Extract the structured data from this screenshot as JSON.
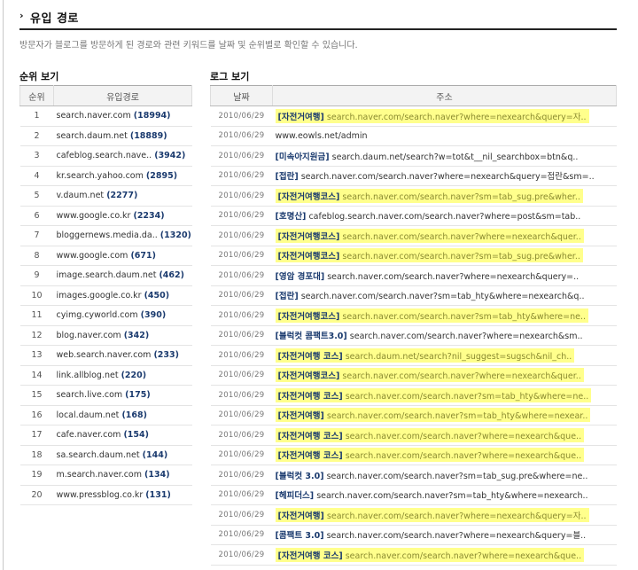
{
  "header": {
    "title": "유입 경로",
    "description": "방문자가 블로그를 방문하게 된 경로와 관련 키워드를 날짜 및 순위별로 확인할 수 있습니다."
  },
  "rank_section": {
    "label": "순위 보기",
    "columns": [
      "순위",
      "유입경로"
    ],
    "rows": [
      {
        "rank": "1",
        "source": "search.naver.com",
        "count": "(18994)"
      },
      {
        "rank": "2",
        "source": "search.daum.net",
        "count": "(18889)"
      },
      {
        "rank": "3",
        "source": "cafeblog.search.nave..",
        "count": "(3942)"
      },
      {
        "rank": "4",
        "source": "kr.search.yahoo.com",
        "count": "(2895)"
      },
      {
        "rank": "5",
        "source": "v.daum.net",
        "count": "(2277)"
      },
      {
        "rank": "6",
        "source": "www.google.co.kr",
        "count": "(2234)"
      },
      {
        "rank": "7",
        "source": "bloggernews.media.da..",
        "count": "(1320)"
      },
      {
        "rank": "8",
        "source": "www.google.com",
        "count": "(671)"
      },
      {
        "rank": "9",
        "source": "image.search.daum.net",
        "count": "(462)"
      },
      {
        "rank": "10",
        "source": "images.google.co.kr",
        "count": "(450)"
      },
      {
        "rank": "11",
        "source": "cyimg.cyworld.com",
        "count": "(390)"
      },
      {
        "rank": "12",
        "source": "blog.naver.com",
        "count": "(342)"
      },
      {
        "rank": "13",
        "source": "web.search.naver.com",
        "count": "(233)"
      },
      {
        "rank": "14",
        "source": "link.allblog.net",
        "count": "(220)"
      },
      {
        "rank": "15",
        "source": "search.live.com",
        "count": "(175)"
      },
      {
        "rank": "16",
        "source": "local.daum.net",
        "count": "(168)"
      },
      {
        "rank": "17",
        "source": "cafe.naver.com",
        "count": "(154)"
      },
      {
        "rank": "18",
        "source": "sa.search.daum.net",
        "count": "(144)"
      },
      {
        "rank": "19",
        "source": "m.search.naver.com",
        "count": "(134)"
      },
      {
        "rank": "20",
        "source": "www.pressblog.co.kr",
        "count": "(131)"
      }
    ]
  },
  "log_section": {
    "label": "로그 보기",
    "columns": [
      "날짜",
      "주소"
    ],
    "rows": [
      {
        "date": "2010/06/29",
        "keyword": "[자전거여행]",
        "url": "search.naver.com/search.naver?where=nexearch&query=자..",
        "highlight": true
      },
      {
        "date": "2010/06/29",
        "keyword": "",
        "url": "www.eowls.net/admin",
        "highlight": false
      },
      {
        "date": "2010/06/29",
        "keyword": "[미속아지원금]",
        "url": "search.daum.net/search?w=tot&t__nil_searchbox=btn&q..",
        "highlight": false
      },
      {
        "date": "2010/06/29",
        "keyword": "[접란]",
        "url": "search.naver.com/search.naver?where=nexearch&query=접란&sm=..",
        "highlight": false
      },
      {
        "date": "2010/06/29",
        "keyword": "[자전거여행코스]",
        "url": "search.naver.com/search.naver?sm=tab_sug.pre&wher..",
        "highlight": true
      },
      {
        "date": "2010/06/29",
        "keyword": "[호명산]",
        "url": "cafeblog.search.naver.com/search.naver?where=post&sm=tab..",
        "highlight": false
      },
      {
        "date": "2010/06/29",
        "keyword": "[자전거여행코스]",
        "url": "search.naver.com/search.naver?where=nexearch&quer..",
        "highlight": true
      },
      {
        "date": "2010/06/29",
        "keyword": "[자전거여행코스]",
        "url": "search.naver.com/search.naver?sm=tab_sug.pre&wher..",
        "highlight": true
      },
      {
        "date": "2010/06/29",
        "keyword": "[영암 경포대]",
        "url": "search.naver.com/search.naver?where=nexearch&query=..",
        "highlight": false
      },
      {
        "date": "2010/06/29",
        "keyword": "[접란]",
        "url": "search.naver.com/search.naver?sm=tab_hty&where=nexearch&q..",
        "highlight": false
      },
      {
        "date": "2010/06/29",
        "keyword": "[자전거여행코스]",
        "url": "search.naver.com/search.naver?sm=tab_hty&where=ne..",
        "highlight": true
      },
      {
        "date": "2010/06/29",
        "keyword": "[블럭컷 콤팩트3.0]",
        "url": "search.naver.com/search.naver?where=nexearch&sm..",
        "highlight": false
      },
      {
        "date": "2010/06/29",
        "keyword": "[자전거여행 코스]",
        "url": "search.daum.net/search?nil_suggest=sugsch&nil_ch..",
        "highlight": true
      },
      {
        "date": "2010/06/29",
        "keyword": "[자전거여행코스]",
        "url": "search.naver.com/search.naver?where=nexearch&quer..",
        "highlight": true
      },
      {
        "date": "2010/06/29",
        "keyword": "[자전거여행 코스]",
        "url": "search.naver.com/search.naver?sm=tab_hty&where=ne..",
        "highlight": true
      },
      {
        "date": "2010/06/29",
        "keyword": "[자전거여행]",
        "url": "search.naver.com/search.naver?sm=tab_hty&where=nexear..",
        "highlight": true
      },
      {
        "date": "2010/06/29",
        "keyword": "[자전거여행 코스]",
        "url": "search.naver.com/search.naver?where=nexearch&que..",
        "highlight": true
      },
      {
        "date": "2010/06/29",
        "keyword": "[자전거여행 코스]",
        "url": "search.naver.com/search.naver?where=nexearch&que..",
        "highlight": true
      },
      {
        "date": "2010/06/29",
        "keyword": "[블럭컷 3.0]",
        "url": "search.naver.com/search.naver?sm=tab_sug.pre&where=ne..",
        "highlight": false
      },
      {
        "date": "2010/06/29",
        "keyword": "[헤피더스]",
        "url": "search.naver.com/search.naver?sm=tab_hty&where=nexearch..",
        "highlight": false
      },
      {
        "date": "2010/06/29",
        "keyword": "[자전거여행]",
        "url": "search.naver.com/search.naver?where=nexearch&query=자..",
        "highlight": true
      },
      {
        "date": "2010/06/29",
        "keyword": "[콤팩트 3.0]",
        "url": "search.naver.com/search.naver?where=nexearch&query=블..",
        "highlight": false
      },
      {
        "date": "2010/06/29",
        "keyword": "[자전거여행 코스]",
        "url": "search.naver.com/search.naver?where=nexearch&que..",
        "highlight": true
      }
    ]
  }
}
